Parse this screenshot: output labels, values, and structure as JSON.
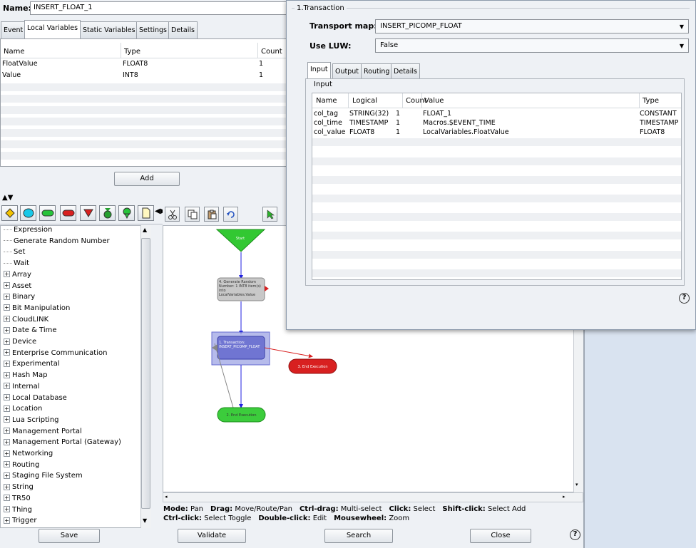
{
  "name_field": {
    "label": "Name:",
    "value": "INSERT_FLOAT_1"
  },
  "main_tabs": [
    "Event",
    "Local Variables",
    "Static Variables",
    "Settings",
    "Details"
  ],
  "local_vars": {
    "headers": [
      "Name",
      "Type",
      "Count"
    ],
    "rows": [
      {
        "name": "FloatValue",
        "type": "FLOAT8",
        "count": "1"
      },
      {
        "name": "Value",
        "type": "INT8",
        "count": "1"
      }
    ],
    "add_label": "Add"
  },
  "tree_items": [
    {
      "label": "Expression",
      "expandable": false
    },
    {
      "label": "Generate Random Number",
      "expandable": false
    },
    {
      "label": "Set",
      "expandable": false
    },
    {
      "label": "Wait",
      "expandable": false
    },
    {
      "label": "Array",
      "expandable": true
    },
    {
      "label": "Asset",
      "expandable": true
    },
    {
      "label": "Binary",
      "expandable": true
    },
    {
      "label": "Bit Manipulation",
      "expandable": true
    },
    {
      "label": "CloudLINK",
      "expandable": true
    },
    {
      "label": "Date & Time",
      "expandable": true
    },
    {
      "label": "Device",
      "expandable": true
    },
    {
      "label": "Enterprise Communication",
      "expandable": true
    },
    {
      "label": "Experimental",
      "expandable": true
    },
    {
      "label": "Hash Map",
      "expandable": true
    },
    {
      "label": "Internal",
      "expandable": true
    },
    {
      "label": "Local Database",
      "expandable": true
    },
    {
      "label": "Location",
      "expandable": true
    },
    {
      "label": "Lua Scripting",
      "expandable": true
    },
    {
      "label": "Management Portal",
      "expandable": true
    },
    {
      "label": "Management Portal (Gateway)",
      "expandable": true
    },
    {
      "label": "Networking",
      "expandable": true
    },
    {
      "label": "Routing",
      "expandable": true
    },
    {
      "label": "Staging File System",
      "expandable": true
    },
    {
      "label": "String",
      "expandable": true
    },
    {
      "label": "TR50",
      "expandable": true
    },
    {
      "label": "Thing",
      "expandable": true
    },
    {
      "label": "Trigger",
      "expandable": true
    }
  ],
  "flow_nodes": {
    "start": "Start",
    "generate": "4. Generate Random Number: 1 INT8 item(s) into LocalVariables.Value",
    "transaction": "1. Transaction: INSERT_PICOMP_FLOAT",
    "end_error": "3. End Execution",
    "end_ok": "2. End Execution"
  },
  "help_text": {
    "line1": [
      {
        "key": "Mode:",
        "val": "Pan"
      },
      {
        "key": "Drag:",
        "val": "Move/Route/Pan"
      },
      {
        "key": "Ctrl-drag:",
        "val": "Multi-select"
      },
      {
        "key": "Click:",
        "val": "Select"
      },
      {
        "key": "Shift-click:",
        "val": "Select Add"
      }
    ],
    "line2": [
      {
        "key": "Ctrl-click:",
        "val": "Select Toggle"
      },
      {
        "key": "Double-click:",
        "val": "Edit"
      },
      {
        "key": "Mousewheel:",
        "val": "Zoom"
      }
    ]
  },
  "bottom_buttons": {
    "save": "Save",
    "validate": "Validate",
    "search": "Search",
    "close": "Close"
  },
  "help_glyph": "?",
  "dialog": {
    "section": "1.Transaction",
    "transport_label": "Transport map:",
    "transport_value": "INSERT_PICOMP_FLOAT",
    "luw_label": "Use LUW:",
    "luw_value": "False",
    "tabs": [
      "Input",
      "Output",
      "Routing",
      "Details"
    ],
    "input_group": "Input",
    "headers": [
      "Name",
      "Logical",
      "Count",
      "Value",
      "Type"
    ],
    "rows": [
      {
        "name": "col_tag",
        "logical": "STRING(32)",
        "count": "1",
        "value": "FLOAT_1",
        "type": "CONSTANT"
      },
      {
        "name": "col_time",
        "logical": "TIMESTAMP",
        "count": "1",
        "value": "Macros.$EVENT_TIME",
        "type": "TIMESTAMP"
      },
      {
        "name": "col_value",
        "logical": "FLOAT8",
        "count": "1",
        "value": "LocalVariables.FloatValue",
        "type": "FLOAT8"
      }
    ]
  },
  "colors": {
    "start": "#3cc43c",
    "generate": "#c8c8c8",
    "transaction": "#7b7fd8",
    "end_error": "#d82020",
    "end_ok": "#3ccc3c"
  }
}
